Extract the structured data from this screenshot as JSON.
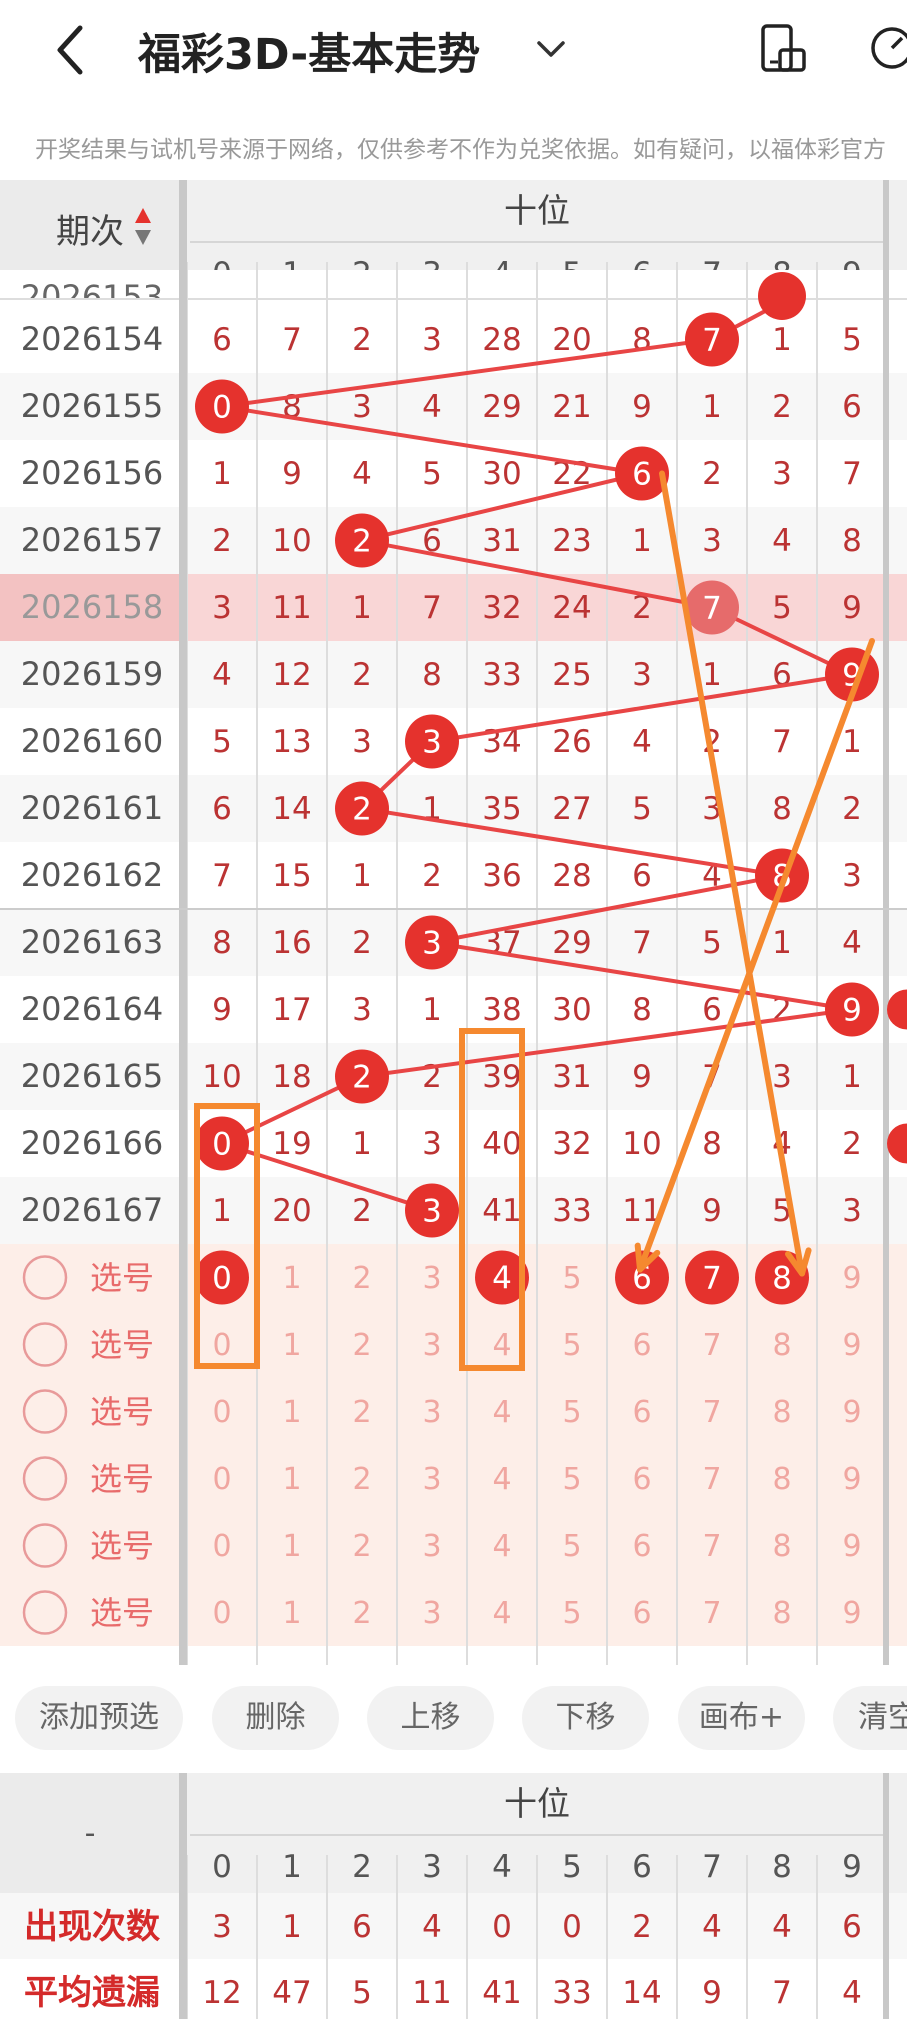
{
  "header": {
    "title": "福彩3D-基本走势",
    "disclaimer": "开奖结果与试机号来源于网络，仅供参考不作为兑奖依据。如有疑问，以福体彩官方"
  },
  "table": {
    "issue_header": "期次",
    "group_header": "十位",
    "digits": [
      "0",
      "1",
      "2",
      "3",
      "4",
      "5",
      "6",
      "7",
      "8",
      "9"
    ],
    "partial_row": [
      "2026153"
    ],
    "rows": [
      {
        "issue": "2026154",
        "cells": [
          "6",
          "7",
          "2",
          "3",
          "28",
          "20",
          "8",
          "7",
          "1",
          "5"
        ],
        "hit": 7
      },
      {
        "issue": "2026155",
        "cells": [
          "0",
          "8",
          "3",
          "4",
          "29",
          "21",
          "9",
          "1",
          "2",
          "6"
        ],
        "hit": 0
      },
      {
        "issue": "2026156",
        "cells": [
          "1",
          "9",
          "4",
          "5",
          "30",
          "22",
          "6",
          "2",
          "3",
          "7"
        ],
        "hit": 6
      },
      {
        "issue": "2026157",
        "cells": [
          "2",
          "10",
          "2",
          "6",
          "31",
          "23",
          "1",
          "3",
          "4",
          "8"
        ],
        "hit": 2
      },
      {
        "issue": "2026158",
        "cells": [
          "3",
          "11",
          "1",
          "7",
          "32",
          "24",
          "2",
          "7",
          "5",
          "9"
        ],
        "hit": 7
      },
      {
        "issue": "2026159",
        "cells": [
          "4",
          "12",
          "2",
          "8",
          "33",
          "25",
          "3",
          "1",
          "6",
          "9"
        ],
        "hit": 9
      },
      {
        "issue": "2026160",
        "cells": [
          "5",
          "13",
          "3",
          "3",
          "34",
          "26",
          "4",
          "2",
          "7",
          "1"
        ],
        "hit": 3
      },
      {
        "issue": "2026161",
        "cells": [
          "6",
          "14",
          "2",
          "1",
          "35",
          "27",
          "5",
          "3",
          "8",
          "2"
        ],
        "hit": 2
      },
      {
        "issue": "2026162",
        "cells": [
          "7",
          "15",
          "1",
          "2",
          "36",
          "28",
          "6",
          "4",
          "8",
          "3"
        ],
        "hit": 8
      },
      {
        "issue": "2026163",
        "cells": [
          "8",
          "16",
          "2",
          "3",
          "37",
          "29",
          "7",
          "5",
          "1",
          "4"
        ],
        "hit": 3
      },
      {
        "issue": "2026164",
        "cells": [
          "9",
          "17",
          "3",
          "1",
          "38",
          "30",
          "8",
          "6",
          "2",
          "9"
        ],
        "hit": 9
      },
      {
        "issue": "2026165",
        "cells": [
          "10",
          "18",
          "2",
          "2",
          "39",
          "31",
          "9",
          "7",
          "3",
          "1"
        ],
        "hit": 2
      },
      {
        "issue": "2026166",
        "cells": [
          "0",
          "19",
          "1",
          "3",
          "40",
          "32",
          "10",
          "8",
          "4",
          "2"
        ],
        "hit": 0
      },
      {
        "issue": "2026167",
        "cells": [
          "1",
          "20",
          "2",
          "3",
          "41",
          "33",
          "11",
          "9",
          "5",
          "3"
        ],
        "hit": 3
      }
    ],
    "pick_label": "选号",
    "pick_rows": [
      {
        "selected": [
          0,
          4,
          6,
          7,
          8
        ]
      },
      {
        "selected": []
      },
      {
        "selected": []
      },
      {
        "selected": []
      },
      {
        "selected": []
      },
      {
        "selected": []
      }
    ]
  },
  "buttons": [
    "添加预选",
    "删除",
    "上移",
    "下移",
    "画布+",
    "清空"
  ],
  "stats": {
    "corner": "-",
    "group_header": "十位",
    "rows": [
      {
        "label": "出现次数",
        "values": [
          "3",
          "1",
          "6",
          "4",
          "0",
          "0",
          "2",
          "4",
          "4",
          "6"
        ]
      },
      {
        "label": "平均遗漏",
        "values": [
          "12",
          "47",
          "5",
          "11",
          "41",
          "33",
          "14",
          "9",
          "7",
          "4"
        ]
      }
    ]
  },
  "colors": {
    "accent": "#e5322d",
    "highlight": "#f9d6d6",
    "pick_bg": "#fdeee8",
    "annotation": "#f5892f",
    "line": "#e84545"
  }
}
